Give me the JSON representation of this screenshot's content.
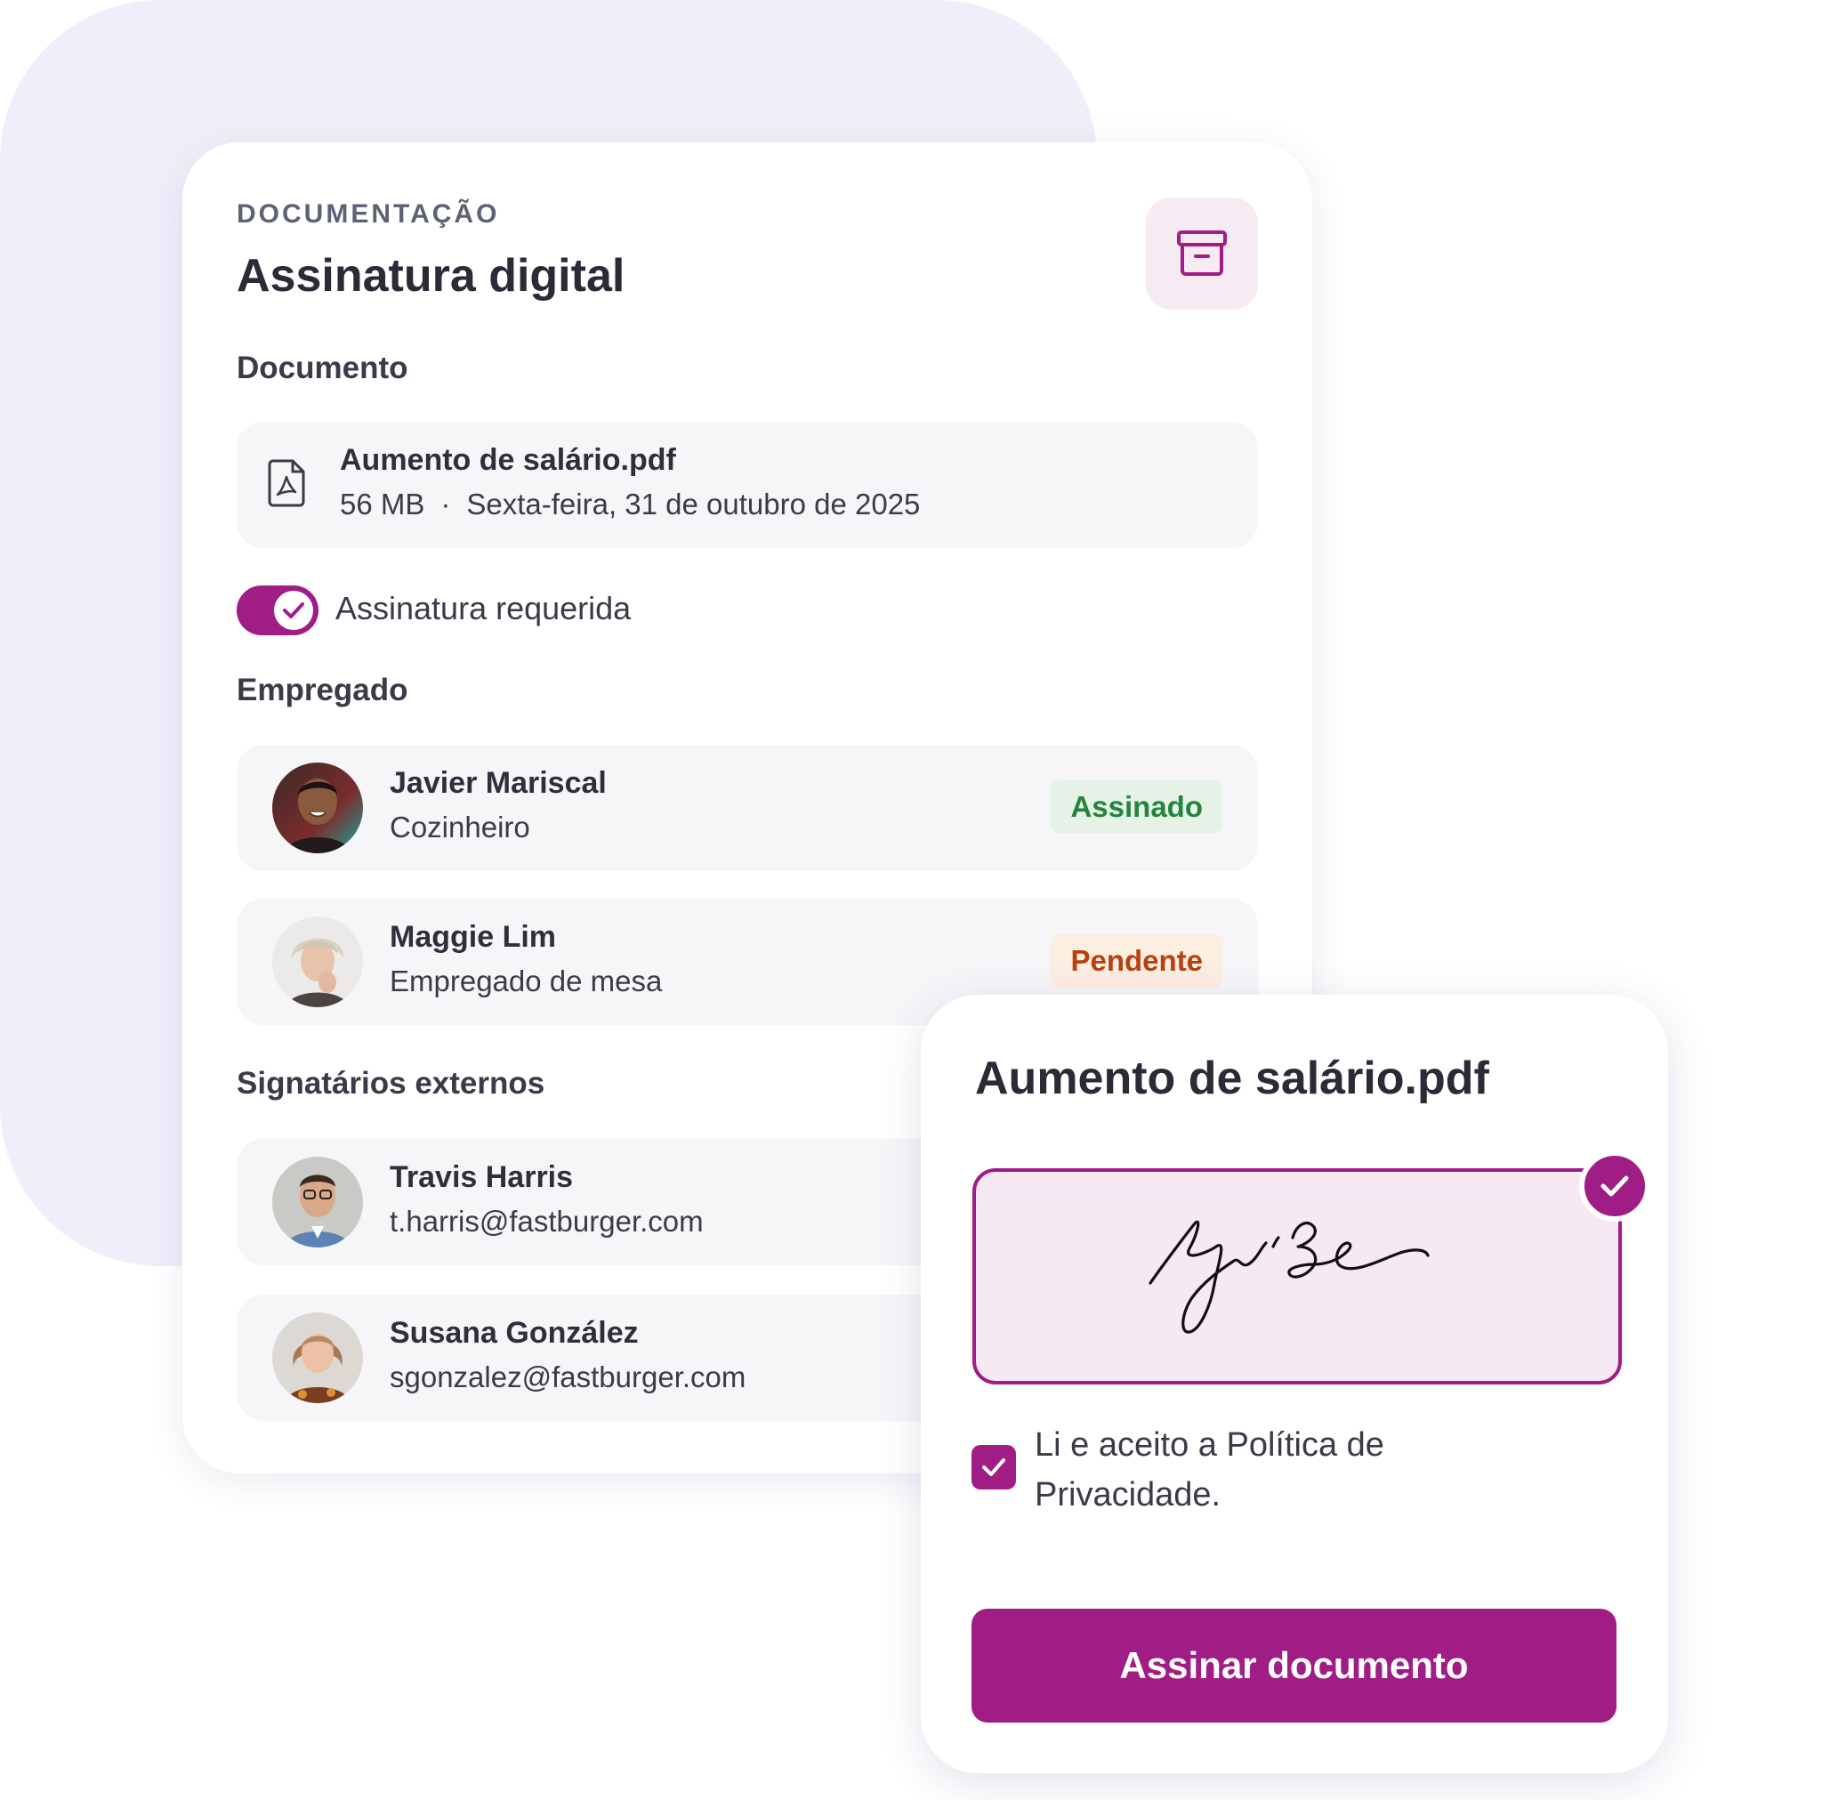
{
  "panel": {
    "eyebrow": "DOCUMENTAÇÃO",
    "title": "Assinatura digital",
    "archive_icon": "archive-box-icon"
  },
  "document": {
    "section_label": "Documento",
    "file_icon": "pdf-file-icon",
    "name": "Aumento de salário.pdf",
    "size": "56 MB",
    "separator": "·",
    "date": "Sexta-feira, 31 de outubro de 2025"
  },
  "signature_required": {
    "label": "Assinatura requerida",
    "enabled": true
  },
  "employees": {
    "section_label": "Empregado",
    "items": [
      {
        "name": "Javier Mariscal",
        "role": "Cozinheiro",
        "status": "Assinado",
        "status_color": "#25843c"
      },
      {
        "name": "Maggie Lim",
        "role": "Empregado de mesa",
        "status": "Pendente",
        "status_color": "#b8410f"
      }
    ]
  },
  "external_signers": {
    "section_label": "Signatários externos",
    "items": [
      {
        "name": "Travis Harris",
        "email": "t.harris@fastburger.com"
      },
      {
        "name": "Susana González",
        "email": "sgonzalez@fastburger.com"
      }
    ]
  },
  "sign_dialog": {
    "title": "Aumento de salário.pdf",
    "policy_text": "Li e aceito a Política de Privacidade.",
    "policy_checked": true,
    "button_label": "Assinar documento"
  },
  "colors": {
    "accent": "#a01d86",
    "background_blob": "#f1eefb",
    "row_background": "#f6f6f9"
  }
}
